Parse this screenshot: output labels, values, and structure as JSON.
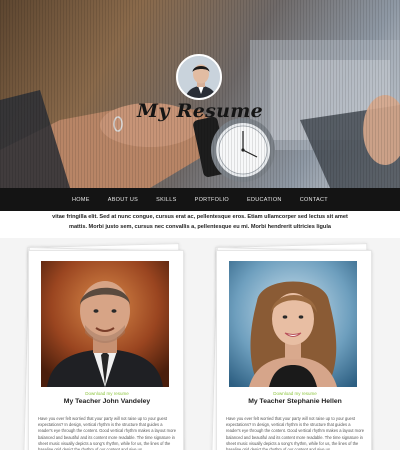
{
  "hero": {
    "title": "My Resume"
  },
  "nav": {
    "items": [
      "HOME",
      "ABOUT US",
      "SKILLS",
      "PORTFOLIO",
      "EDUCATION",
      "CONTACT"
    ]
  },
  "intro": {
    "line1": "vitae fringilla elit. Sed at nunc congue, cursus erat ac, pellentesque eros. Etiam ullamcorper sed lectus sit amet",
    "line2": "mattis. Morbi justo sem, cursus nec convallis a, pellentesque eu mi. Morbi hendrerit ultricies ligula"
  },
  "cards": [
    {
      "download": "Download my resume",
      "name": "My Teacher John Vandeley",
      "desc": "Have you ever felt worried that your party will not raise up to your guest expectations? In design, vertical rhythm is the structure that guides a reader's eye through the content. Good vertical rhythm makes a layout more balanced and beautiful and its content more readable. The time signature in sheet music visually depicts a song's rhythm, while for us, the lines of the baseline grid depict the rhythm of our content and give us"
    },
    {
      "download": "Download my resume",
      "name": "My Teacher Stephanie Hellen",
      "desc": "Have you ever felt worried that your party will not raise up to your guest expectations? In design, vertical rhythm is the structure that guides a reader's eye through the content. Good vertical rhythm makes a layout more balanced and beautiful and its content more readable. The time signature in sheet music visually depicts a song's rhythm, while for us, the lines of the baseline grid depict the rhythm of our content and give us"
    }
  ]
}
